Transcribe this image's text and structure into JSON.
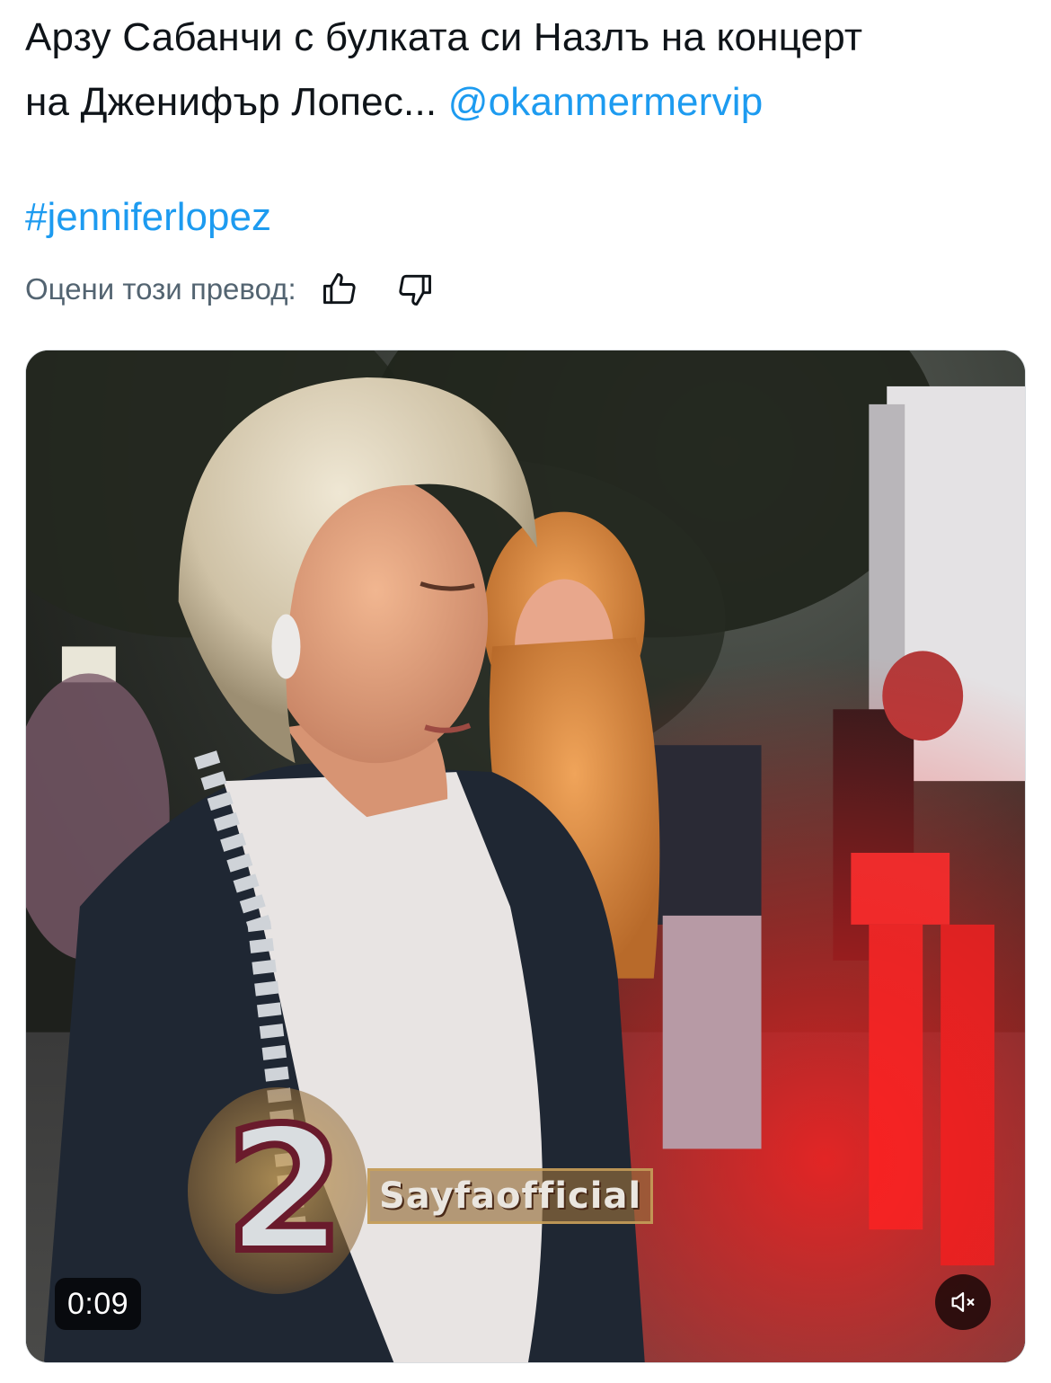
{
  "tweet": {
    "text_line1": "Арзу Сабанчи с булката си Назлъ на концерт",
    "text_line2": "на Дженифър Лопес...",
    "mention": "@okanmermervip",
    "hashtag": "#jenniferlopez"
  },
  "translation_rating": {
    "label": "Оцени този превод:",
    "thumbs_up_icon": "thumbs-up-icon",
    "thumbs_down_icon": "thumbs-down-icon"
  },
  "video": {
    "elapsed_time": "0:09",
    "watermark_number": "2",
    "watermark_text": "Sayfaofficial",
    "muted": true,
    "mute_icon": "speaker-muted-icon"
  },
  "colors": {
    "link": "#1d9bf0",
    "text": "#0f1419",
    "secondary_text": "#536471"
  }
}
